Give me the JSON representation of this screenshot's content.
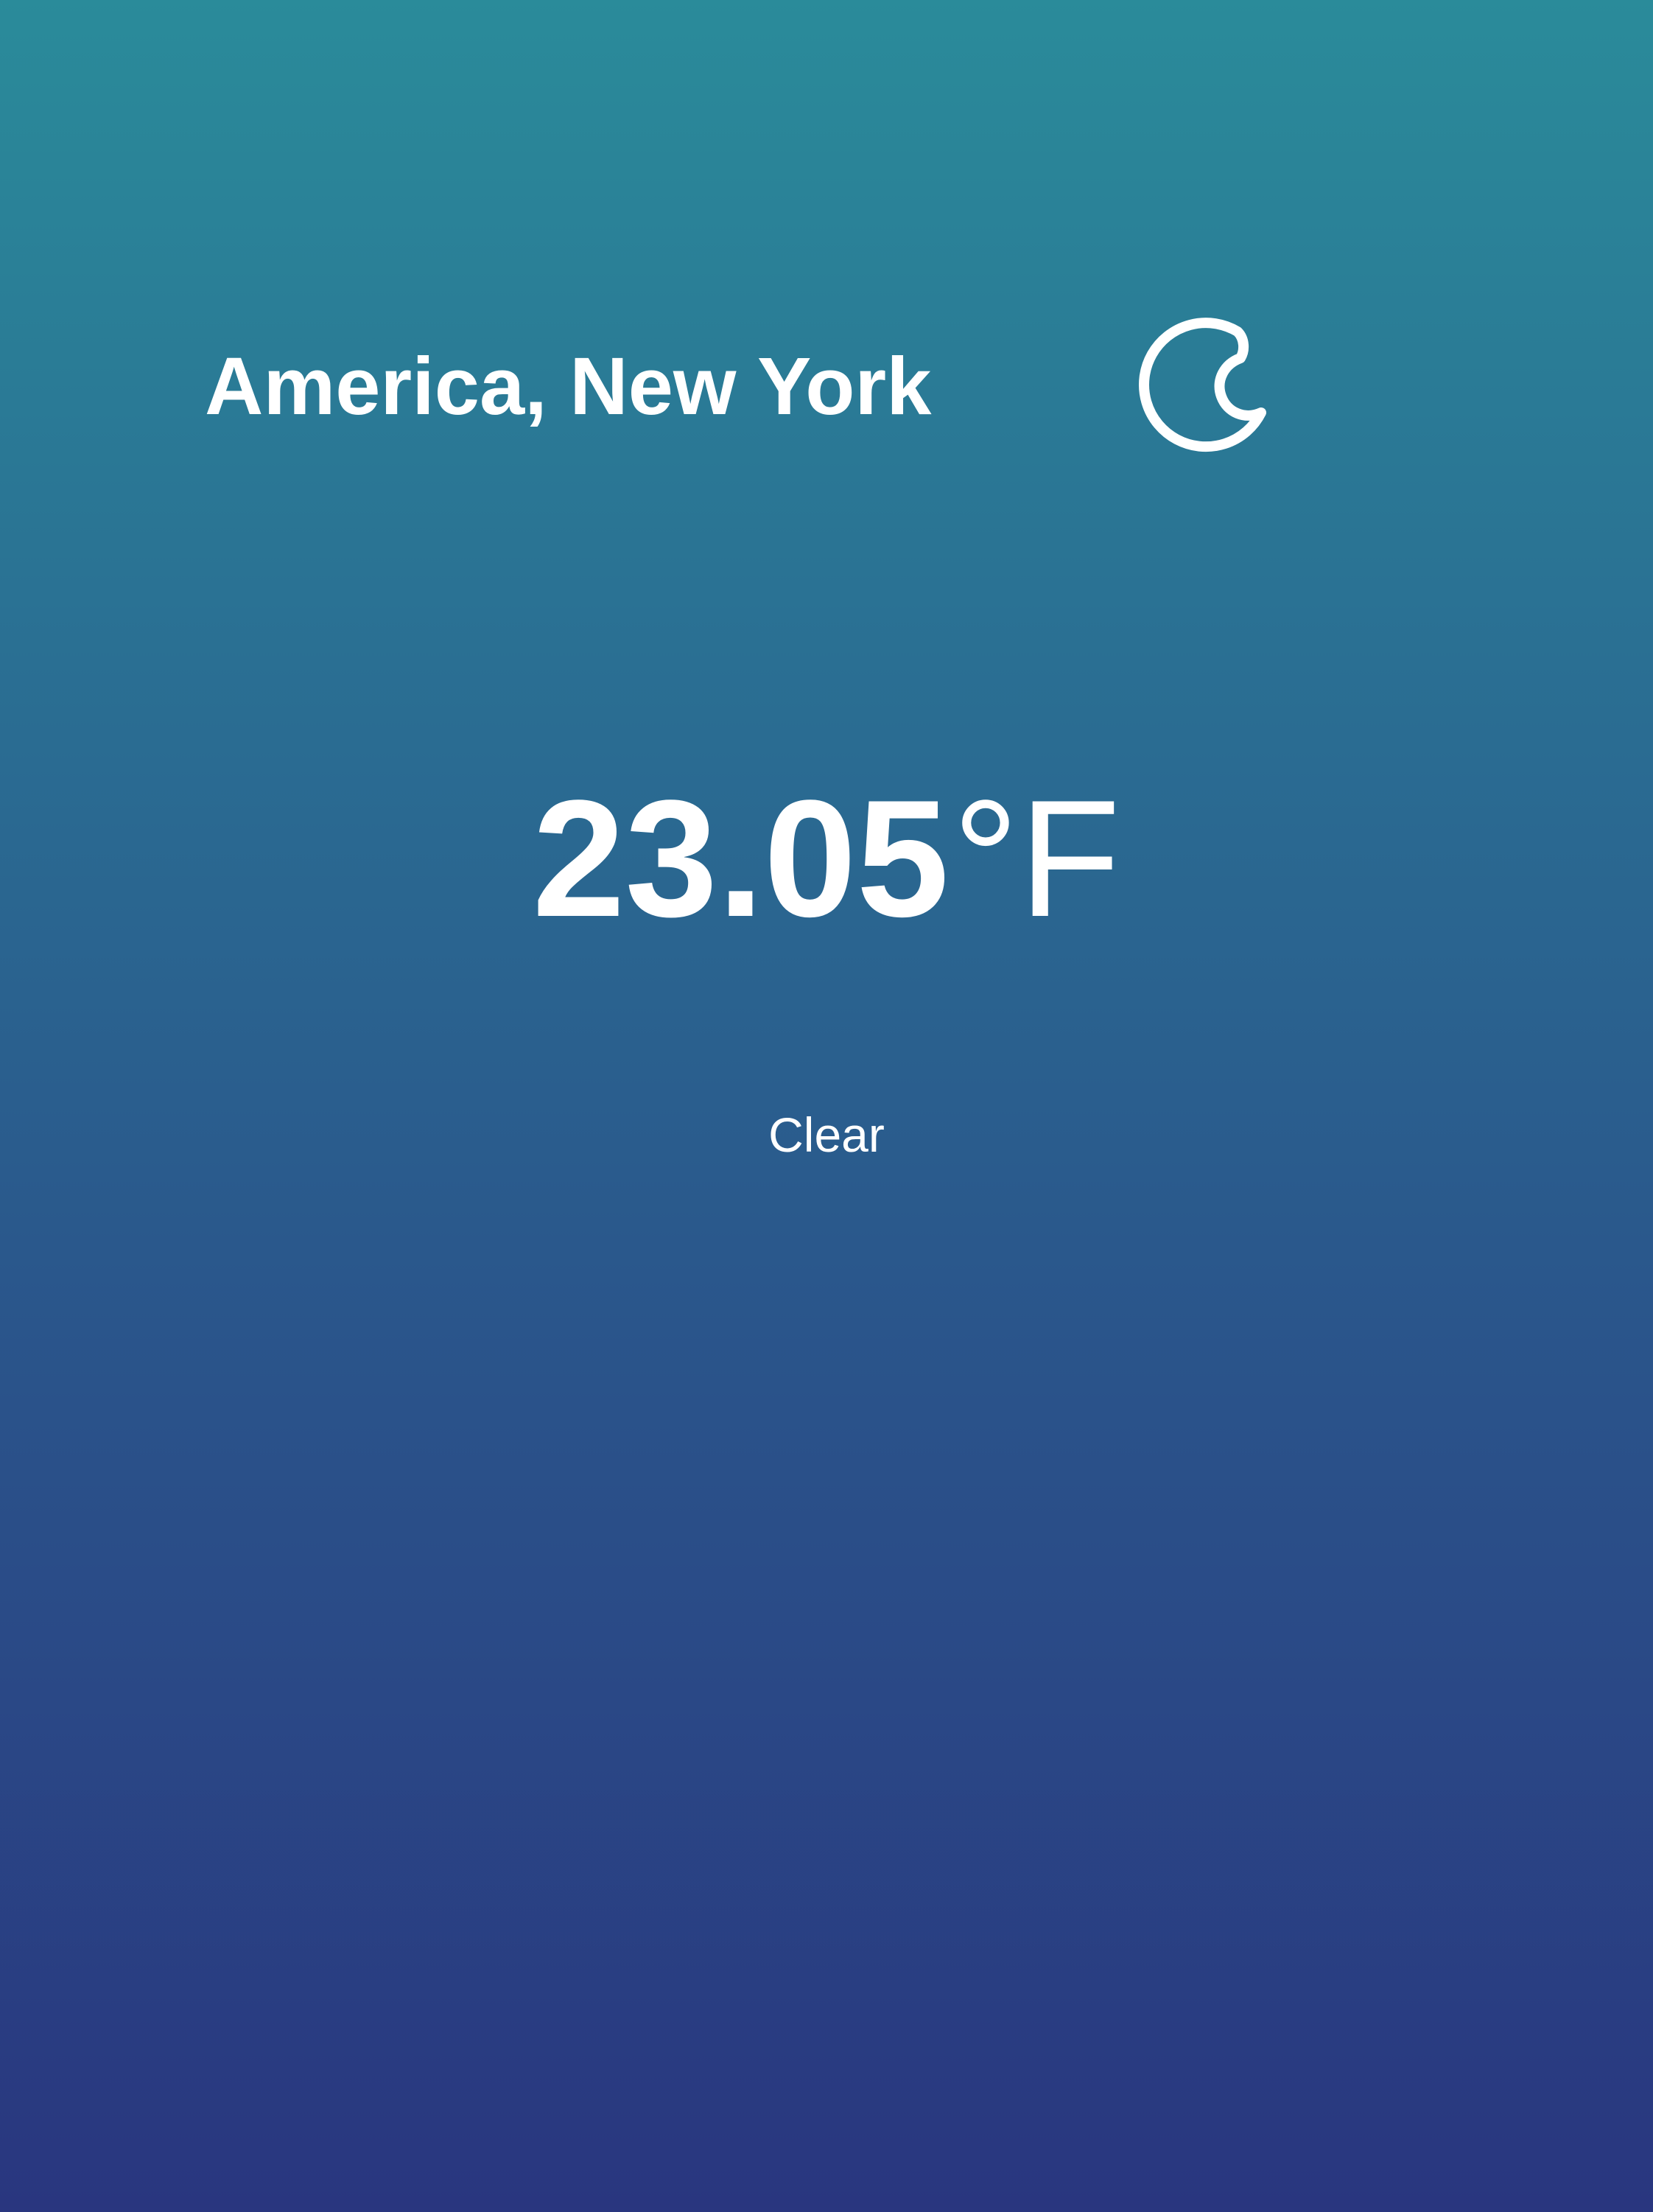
{
  "weather": {
    "location": "America, New York",
    "icon": "moon-icon",
    "temperature_value": "23.05",
    "temperature_unit": "°F",
    "condition": "Clear"
  },
  "colors": {
    "background_top": "#2a8b9a",
    "background_bottom": "#29367f",
    "text": "#ffffff"
  }
}
